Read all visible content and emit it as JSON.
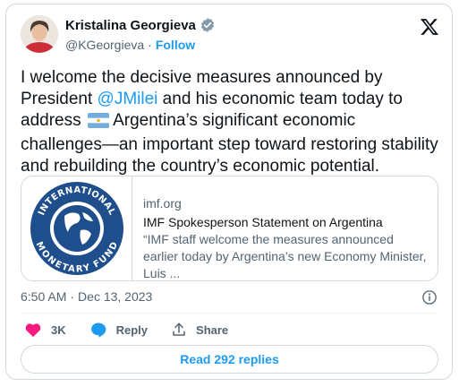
{
  "author": {
    "name": "Kristalina Georgieva",
    "handle": "@KGeorgieva",
    "separator": "·",
    "follow_label": "Follow"
  },
  "tweet": {
    "text_before_mention": "I welcome the decisive measures announced by President ",
    "mention": "@JMilei",
    "text_after_mention": " and his economic team today to address ",
    "flag_icon": "argentina-flag-icon",
    "text_after_flag": " Argentina’s significant economic challenges—an important step toward restoring stability and rebuilding the country’s economic potential."
  },
  "link_card": {
    "domain": "imf.org",
    "title": "IMF Spokesperson Statement on Argentina",
    "description": "“IMF staff welcome the measures announced earlier today by Argentina’s new Economy Minister, Luis ...",
    "logo_top_text": "INTERNATIONAL",
    "logo_bottom_text": "MONETARY FUND"
  },
  "meta": {
    "time": "6:50 AM",
    "separator": "·",
    "date": "Dec 13, 2023"
  },
  "actions": {
    "likes_count": "3K",
    "reply_label": "Reply",
    "share_label": "Share"
  },
  "replies_button": "Read 292 replies",
  "colors": {
    "accent": "#1d9bf0",
    "like": "#f91880",
    "text": "#0f1419",
    "secondary": "#536471",
    "imf_blue": "#1f4e8c"
  }
}
